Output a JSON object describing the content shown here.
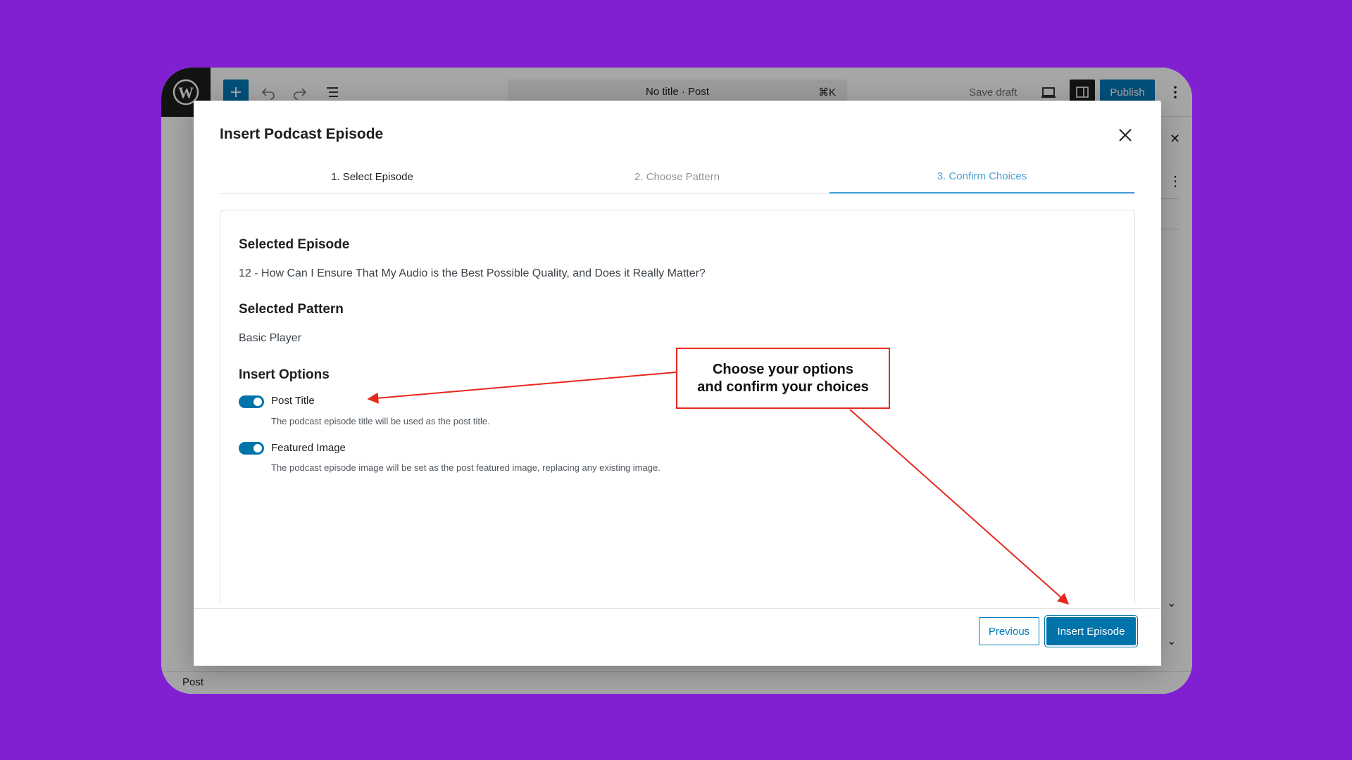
{
  "toolbar": {
    "doc_title": "No title · Post",
    "shortcut": "⌘K",
    "save_draft": "Save draft",
    "publish": "Publish"
  },
  "status_bar": {
    "label": "Post"
  },
  "modal": {
    "title": "Insert Podcast Episode",
    "tabs": [
      {
        "label": "1. Select Episode"
      },
      {
        "label": "2. Choose Pattern"
      },
      {
        "label": "3. Confirm Choices"
      }
    ],
    "selected_episode_heading": "Selected Episode",
    "selected_episode_value": "12 - How Can I Ensure That My Audio is the Best Possible Quality, and Does it Really Matter?",
    "selected_pattern_heading": "Selected Pattern",
    "selected_pattern_value": "Basic Player",
    "insert_options_heading": "Insert Options",
    "options": [
      {
        "label": "Post Title",
        "help": "The podcast episode title will be used as the post title.",
        "enabled": true
      },
      {
        "label": "Featured Image",
        "help": "The podcast episode image will be set as the post featured image, replacing any existing image.",
        "enabled": true
      }
    ],
    "previous_button": "Previous",
    "insert_button": "Insert Episode"
  },
  "annotation": {
    "callout_text": "Choose your options\nand confirm your choices",
    "color": "#e8281c"
  },
  "colors": {
    "background": "#8120d1",
    "accent": "#007cba"
  }
}
